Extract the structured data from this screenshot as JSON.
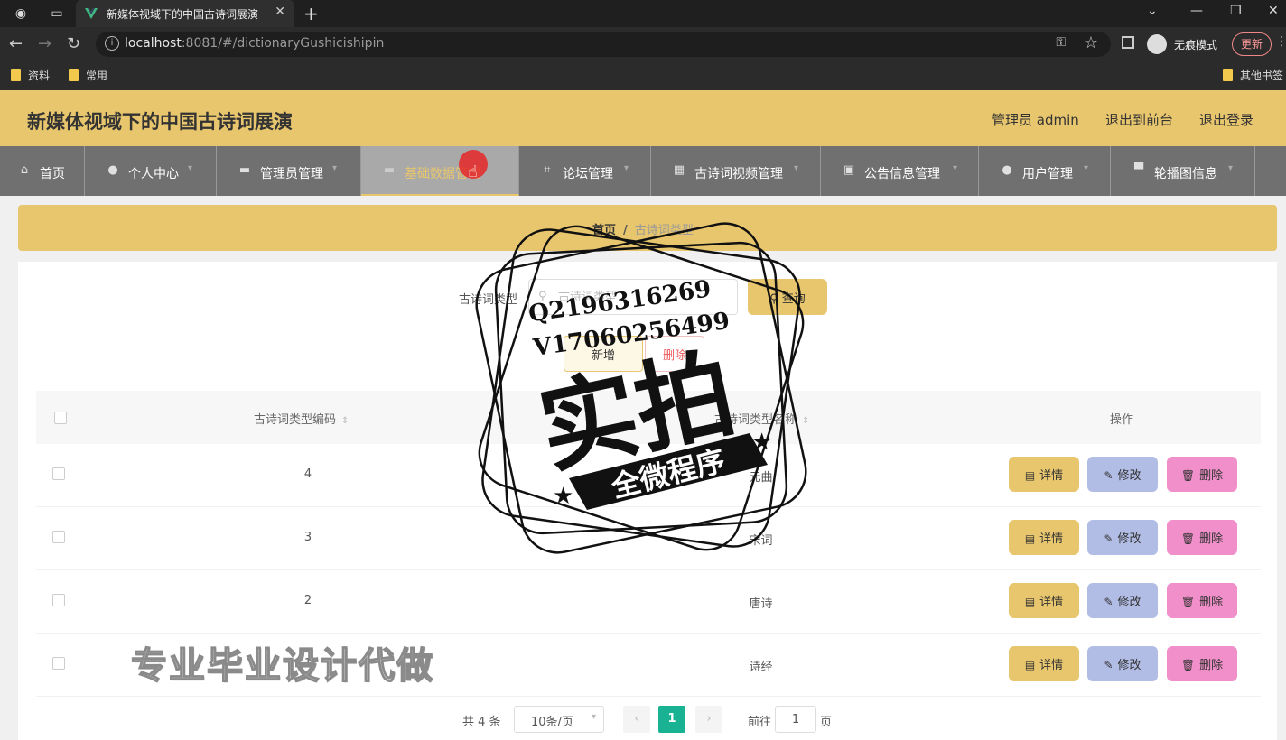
{
  "browser": {
    "tab_title": "新媒体视域下的中国古诗词展演",
    "url_host": "localhost",
    "url_rest": ":8081/#/dictionaryGushicishipin",
    "incognito_label": "无痕模式",
    "update_label": "更新",
    "bookmarks": [
      "资料",
      "常用"
    ],
    "other_bookmarks": "其他书签"
  },
  "header": {
    "title": "新媒体视域下的中国古诗词展演",
    "user": "管理员 admin",
    "to_front": "退出到前台",
    "logout": "退出登录"
  },
  "nav": [
    {
      "label": "首页"
    },
    {
      "label": "个人中心"
    },
    {
      "label": "管理员管理"
    },
    {
      "label": "基础数据管理"
    },
    {
      "label": "论坛管理"
    },
    {
      "label": "古诗词视频管理"
    },
    {
      "label": "公告信息管理"
    },
    {
      "label": "用户管理"
    },
    {
      "label": "轮播图信息"
    }
  ],
  "breadcrumb": {
    "home": "首页",
    "separator": "/",
    "current": "古诗词类型"
  },
  "search": {
    "label": "古诗词类型",
    "placeholder": "古诗词类型",
    "button": "查询"
  },
  "actions": {
    "add": "新增",
    "delete": "删除"
  },
  "table": {
    "headers": {
      "code": "古诗词类型编码",
      "name": "古诗词类型名称",
      "ops": "操作"
    },
    "rows": [
      {
        "code": "4",
        "name": "元曲"
      },
      {
        "code": "3",
        "name": "宋词"
      },
      {
        "code": "2",
        "name": "唐诗"
      },
      {
        "code": "1",
        "name": "诗经"
      }
    ],
    "op_labels": {
      "detail": "详情",
      "edit": "修改",
      "delete": "删除"
    }
  },
  "pagination": {
    "total": "共 4 条",
    "page_size": "10条/页",
    "current": "1",
    "goto": "前往",
    "goto_value": "1",
    "unit": "页"
  },
  "watermark": {
    "contact_q": "Q2196316269",
    "contact_v": "V17060256499",
    "big": "实拍",
    "banner": "全微程序",
    "footer": "专业毕业设计代做"
  },
  "colors": {
    "accent": "#e8c66d",
    "nav_bg": "#707070",
    "pager_active": "#19b394",
    "edit": "#b2bde6",
    "delete": "#f08fc9"
  }
}
